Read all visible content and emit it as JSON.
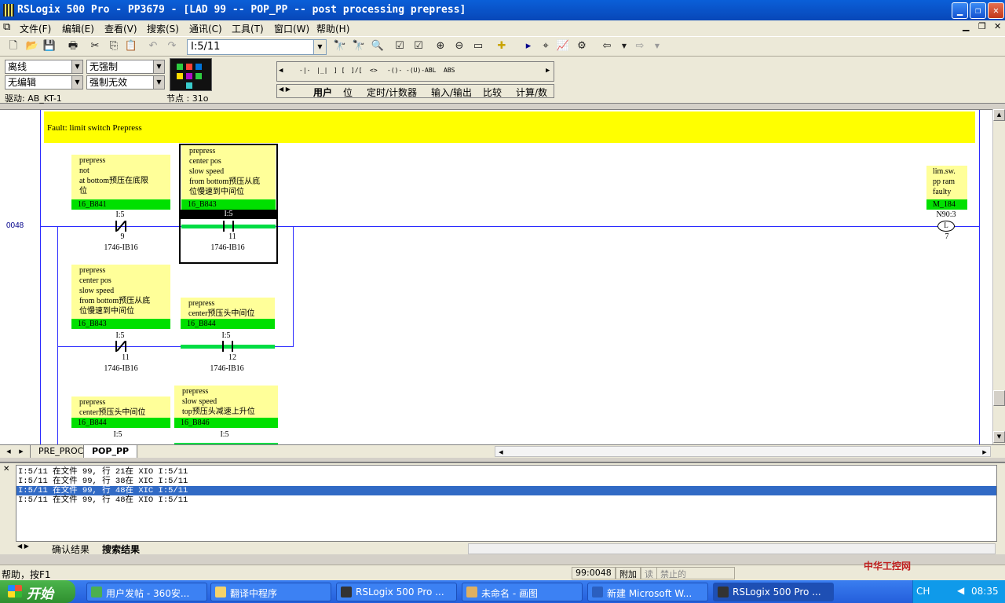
{
  "window": {
    "title": "RSLogix 500 Pro - PP3679 - [LAD 99 -- POP_PP -- post processing prepress]"
  },
  "menu": [
    "文件(F)",
    "编辑(E)",
    "查看(V)",
    "搜索(S)",
    "通讯(C)",
    "工具(T)",
    "窗口(W)",
    "帮助(H)"
  ],
  "toolbar": {
    "address_value": "I:5/11"
  },
  "online": {
    "mode": "离线",
    "forces": "无强制",
    "edits": "无编辑",
    "forces_enabled": "强制无效",
    "driver": "驱动: AB_KT-1",
    "nodes": "节点 : 31o"
  },
  "instruction_bar": {
    "items": [
      "-|-",
      "|_|",
      "] [",
      "]/[",
      "<>",
      "-()-",
      "-(U)-",
      "ABL",
      "ABS"
    ],
    "tabs": [
      "用户",
      "位",
      "定时/计数器",
      "输入/输出",
      "比较",
      "计算/数"
    ]
  },
  "ladder": {
    "rung_number": "0048",
    "rung_comment": "Fault: limit switch Prepress",
    "branch1": [
      {
        "lines": [
          "prepress",
          "not",
          "at bottom预压在底限",
          "位"
        ],
        "symbol": "16_B841",
        "addr": "I:5",
        "bit": "9",
        "module": "1746-IB16",
        "type": "XIO"
      },
      {
        "lines": [
          "prepress",
          "center pos",
          "slow speed",
          "from bottom预压从底",
          "位慢速到中间位"
        ],
        "symbol": "16_B843",
        "addr": "I:5",
        "bit": "11",
        "module": "1746-IB16",
        "type": "XIC"
      }
    ],
    "branch2": [
      {
        "lines": [
          "prepress",
          "center pos",
          "slow speed",
          "from bottom预压从底",
          "位慢速到中间位"
        ],
        "symbol": "16_B843",
        "addr": "I:5",
        "bit": "11",
        "module": "1746-IB16",
        "type": "XIO"
      },
      {
        "lines": [
          "prepress",
          "center预压头中间位"
        ],
        "symbol": "16_B844",
        "addr": "I:5",
        "bit": "12",
        "module": "1746-IB16",
        "type": "XIC"
      }
    ],
    "branch3": [
      {
        "lines": [
          "prepress",
          "center预压头中间位"
        ],
        "symbol": "16_B844",
        "addr": "I:5"
      },
      {
        "lines": [
          "prepress",
          "slow speed",
          "top预压头减速上升位"
        ],
        "symbol": "16_B846",
        "addr": "I:5"
      }
    ],
    "output": {
      "lines": [
        "lim.sw.",
        "pp ram",
        "faulty"
      ],
      "symbol": "M_184",
      "addr": "N90:3",
      "bit": "7"
    }
  },
  "sheets": [
    "PRE_PROC",
    "POP_PP"
  ],
  "results": {
    "lines": [
      "I:5/11 在文件 99, 行 21在 XIO I:5/11",
      "I:5/11 在文件 99, 行 38在 XIC I:5/11",
      "I:5/11 在文件 99, 行 48在 XIC I:5/11",
      "I:5/11 在文件 99, 行 48在 XIO I:5/11"
    ],
    "selected_index": 2,
    "tabs": [
      "确认结果",
      "搜索结果"
    ]
  },
  "status": {
    "help": "帮助，按F1",
    "position": "99:0048",
    "mode": "附加",
    "read": "读",
    "disabled": "禁止的"
  },
  "taskbar": {
    "start": "开始",
    "tasks": [
      "用户发帖 - 360安...",
      "翻译中程序",
      "RSLogix 500 Pro ...",
      "未命名 - 画图",
      "新建 Microsoft W...",
      "RSLogix 500 Pro ..."
    ],
    "active_index": 5,
    "lang": "CH",
    "clock": "08:35"
  },
  "watermark": "中华工控网",
  "colors": {
    "rail": "#2b2bff",
    "comment_bg": "#ffff99",
    "symbol_bg": "#00e000",
    "fault_bg": "#ffff00"
  }
}
